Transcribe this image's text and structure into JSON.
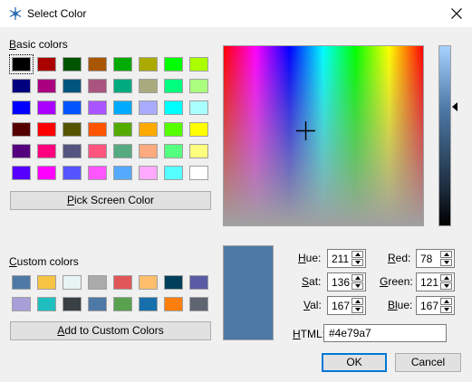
{
  "window": {
    "title": "Select Color",
    "icon": "snowflake-icon",
    "close_icon": "close-icon"
  },
  "basic": {
    "label_first": "B",
    "label_rest": "asic colors",
    "colors": [
      "#000000",
      "#aa0000",
      "#005500",
      "#aa5500",
      "#00aa00",
      "#aaaa00",
      "#00ff00",
      "#aaff00",
      "#00007f",
      "#aa007f",
      "#00557f",
      "#aa557f",
      "#00aa7f",
      "#aaaa7f",
      "#00ff7f",
      "#aaff7f",
      "#0000ff",
      "#aa00ff",
      "#0055ff",
      "#aa55ff",
      "#00aaff",
      "#aaaaff",
      "#00ffff",
      "#aaffff",
      "#550000",
      "#ff0000",
      "#555500",
      "#ff5500",
      "#55aa00",
      "#ffaa00",
      "#55ff00",
      "#ffff00",
      "#55007f",
      "#ff007f",
      "#55557f",
      "#ff557f",
      "#55aa7f",
      "#ffaa7f",
      "#55ff7f",
      "#ffff7f",
      "#5500ff",
      "#ff00ff",
      "#5555ff",
      "#ff55ff",
      "#55aaff",
      "#ffaaff",
      "#55ffff",
      "#ffffff"
    ],
    "selected_index": 0
  },
  "pick_screen": {
    "first": "P",
    "rest": "ick Screen Color"
  },
  "custom": {
    "label_first": "C",
    "label_rest": "ustom colors",
    "colors": [
      "#4e79a7",
      "#f6c343",
      "#e8f4f4",
      "#aaaaaa",
      "#e15759",
      "#ffbe6c",
      "#00405a",
      "#5a5aa5",
      "#a89fd9",
      "#1fbfbf",
      "#3b4045",
      "#4e79a7",
      "#59a14f",
      "#1770ab",
      "#ff7f0e",
      "#5e6470"
    ]
  },
  "add_custom": {
    "first": "A",
    "rest": "dd to Custom Colors"
  },
  "current_color": "#4e79a7",
  "fields": {
    "hue": {
      "first": "H",
      "rest": "ue:",
      "value": "211"
    },
    "sat": {
      "first": "S",
      "rest": "at:",
      "value": "136"
    },
    "val": {
      "first": "V",
      "rest": "al:",
      "value": "167"
    },
    "red": {
      "first": "R",
      "rest": "ed:",
      "value": "78"
    },
    "green": {
      "first": "G",
      "rest": "reen:",
      "value": "121"
    },
    "blue": {
      "first": "Bl",
      "rest": "ue:",
      "value": "167"
    }
  },
  "html_field": {
    "first": "H",
    "rest": "TML:",
    "value": "#4e79a7"
  },
  "buttons": {
    "ok": "OK",
    "cancel": "Cancel"
  }
}
